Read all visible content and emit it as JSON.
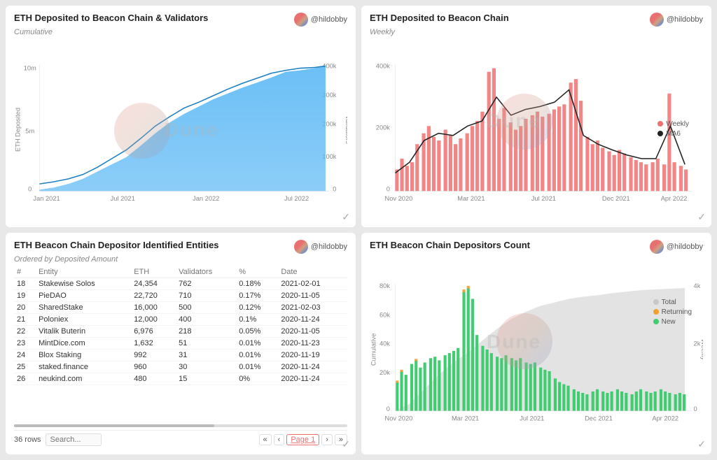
{
  "panels": {
    "panel1": {
      "title": "ETH Deposited to Beacon Chain & Validators",
      "subtitle": "Cumulative",
      "user": "@hildobby",
      "y_left_label": "ETH Deposited",
      "y_right_label": "Validators",
      "x_labels": [
        "Jan 2021",
        "Jul 2021",
        "Jan 2022",
        "Jul 2022"
      ],
      "y_left_ticks": [
        "10m",
        "5m",
        "0"
      ],
      "y_right_ticks": [
        "400k",
        "300k",
        "200k",
        "100k",
        "0"
      ]
    },
    "panel2": {
      "title": "ETH Deposited to Beacon Chain",
      "subtitle": "Weekly",
      "user": "@hildobby",
      "x_labels": [
        "Nov 2020",
        "Mar 2021",
        "Jul 2021",
        "Dec 2021",
        "Apr 2022"
      ],
      "y_ticks": [
        "400k",
        "200k",
        "0"
      ],
      "legend": [
        {
          "label": "Weekly",
          "color": "#f07070",
          "type": "dot"
        },
        {
          "label": "MA6",
          "color": "#222",
          "type": "line"
        }
      ]
    },
    "panel3": {
      "title": "ETH Beacon Chain Depositor Identified Entities",
      "subtitle": "Ordered by Deposited Amount",
      "user": "@hildobby",
      "columns": [
        "#",
        "Entity",
        "ETH",
        "Validators",
        "%",
        "Date"
      ],
      "rows": [
        [
          "18",
          "Stakewise Solos",
          "24,354",
          "762",
          "0.18%",
          "2021-02-01"
        ],
        [
          "19",
          "PieDAO",
          "22,720",
          "710",
          "0.17%",
          "2020-11-05"
        ],
        [
          "20",
          "SharedStake",
          "16,000",
          "500",
          "0.12%",
          "2021-02-03"
        ],
        [
          "21",
          "Poloniex",
          "12,000",
          "400",
          "0.1%",
          "2020-11-24"
        ],
        [
          "22",
          "Vitalik Buterin",
          "6,976",
          "218",
          "0.05%",
          "2020-11-05"
        ],
        [
          "23",
          "MintDice.com",
          "1,632",
          "51",
          "0.01%",
          "2020-11-23"
        ],
        [
          "24",
          "Blox Staking",
          "992",
          "31",
          "0.01%",
          "2020-11-19"
        ],
        [
          "25",
          "staked.finance",
          "960",
          "30",
          "0.01%",
          "2020-11-24"
        ],
        [
          "26",
          "neukind.com",
          "480",
          "15",
          "0%",
          "2020-11-24"
        ]
      ],
      "footer": {
        "rows_label": "36 rows",
        "search_placeholder": "Search...",
        "page_label": "Page 1"
      }
    },
    "panel4": {
      "title": "ETH Beacon Chain Depositors Count",
      "user": "@hildobby",
      "x_labels": [
        "Nov 2020",
        "Mar 2021",
        "Jul 2021",
        "Dec 2021",
        "Apr 2022"
      ],
      "y_left_ticks": [
        "80k",
        "60k",
        "40k",
        "20k",
        "0"
      ],
      "y_right_ticks": [
        "4k",
        "2k",
        "0"
      ],
      "y_left_label": "Cumulative",
      "y_right_label": "Weekly",
      "legend": [
        {
          "label": "Total",
          "color": "#cccccc",
          "type": "dot"
        },
        {
          "label": "Returning",
          "color": "#f0a030",
          "type": "dot"
        },
        {
          "label": "New",
          "color": "#40cc70",
          "type": "dot"
        }
      ]
    }
  },
  "watermark": "Dune"
}
